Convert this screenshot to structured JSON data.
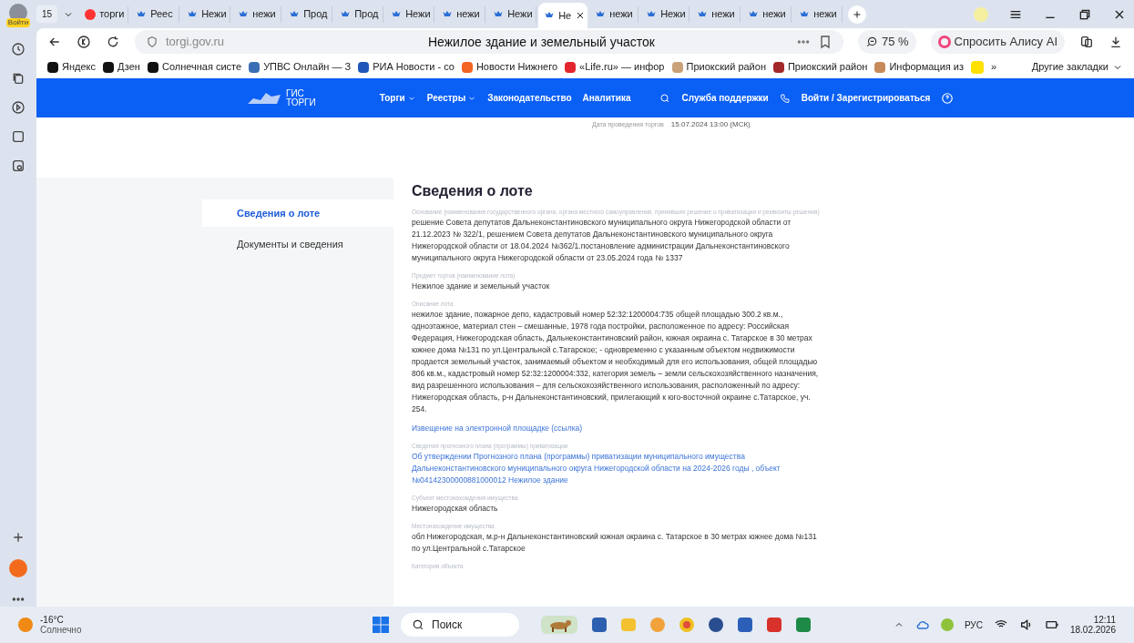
{
  "browser": {
    "login_label": "Войти",
    "tab_count": "15",
    "tabs": [
      {
        "label": "торги",
        "kind": "yandex",
        "selected": false
      },
      {
        "label": "Реес",
        "kind": "site",
        "selected": false
      },
      {
        "label": "Нежи",
        "kind": "site",
        "selected": false
      },
      {
        "label": "нежи",
        "kind": "site",
        "selected": false
      },
      {
        "label": "Прод",
        "kind": "site",
        "selected": false
      },
      {
        "label": "Прод",
        "kind": "site",
        "selected": false
      },
      {
        "label": "Нежи",
        "kind": "site",
        "selected": false
      },
      {
        "label": "нежи",
        "kind": "site",
        "selected": false
      },
      {
        "label": "Нежи",
        "kind": "site",
        "selected": false
      },
      {
        "label": "Не",
        "kind": "site",
        "selected": true
      },
      {
        "label": "нежи",
        "kind": "site",
        "selected": false
      },
      {
        "label": "Нежи",
        "kind": "site",
        "selected": false
      },
      {
        "label": "нежи",
        "kind": "site",
        "selected": false
      },
      {
        "label": "нежи",
        "kind": "site",
        "selected": false
      },
      {
        "label": "нежи",
        "kind": "site",
        "selected": false
      }
    ],
    "address": "torgi.gov.ru",
    "page_title": "Нежилое здание и земельный участок",
    "zoom": "75 %",
    "alice": "Спросить Алису AI",
    "bookmarks": [
      {
        "label": "Яндекс",
        "color": "#111111"
      },
      {
        "label": "Дзен",
        "color": "#111111"
      },
      {
        "label": "Солнечная систе",
        "color": "#111111"
      },
      {
        "label": "УПВС Онлайн — З",
        "color": "#3b6fb5"
      },
      {
        "label": "РИА Новости - со",
        "color": "#1f56b8"
      },
      {
        "label": "Новости Нижнего",
        "color": "#f26522"
      },
      {
        "label": "«Life.ru» — инфор",
        "color": "#e3262d"
      },
      {
        "label": "Приокский район",
        "color": "#c9a27a"
      },
      {
        "label": "Приокский район",
        "color": "#a3282a"
      },
      {
        "label": "Информация из",
        "color": "#c78a5a"
      }
    ],
    "more": "»",
    "other_bookmarks": "Другие закладки"
  },
  "site": {
    "logo_line1": "ГИС",
    "logo_line2": "ТОРГИ",
    "nav": [
      {
        "label": "Торги",
        "kind": "menu"
      },
      {
        "label": "Реестры",
        "kind": "menu"
      },
      {
        "label": "Законодательство",
        "kind": "link"
      },
      {
        "label": "Аналитика",
        "kind": "link"
      }
    ],
    "support": "Служба поддержки",
    "login": "Войти / Зарегистрироваться",
    "date_label": "Дата проведения торгов",
    "date_value": "15.07.2024 13:00 (МСК)",
    "side_menu": [
      {
        "label": "Сведения о лоте",
        "selected": true
      },
      {
        "label": "Документы и сведения",
        "selected": false
      }
    ],
    "heading": "Сведения о лоте",
    "fields": [
      {
        "label": "Основание (наименование государственного органа, органа местного самоуправления, принявших решение о приватизации и реквизиты решения)",
        "value": "решение Совета  депутатов Дальнеконстантиновского муниципального  округа  Нижегородской области от 21.12.2023  № 322/1, решением Совета  депутатов Дальнеконстантиновского муниципального  округа Нижегородской области   от 18.04.2024 №362/1.постановление администрации Дальнеконстантиновского муниципального округа Нижегородской области от 23.05.2024 года № 1337",
        "kind": "text"
      },
      {
        "label": "Предмет торгов (наименование лота)",
        "value": "Нежилое здание и земельный участок",
        "kind": "text"
      },
      {
        "label": "Описание лота",
        "value": "нежилое здание, пожарное депо, кадастровый номер 52:32:1200004:735 общей площадью 300.2 кв.м., одноэтажное, материал стен – смешанные, 1978 года постройки, расположенное по адресу: Российская Федерация, Нижегородская область, Дальнеконстантиновский район, южная окраина с. Татарское в 30 метрах южнее дома №131 по ул.Центральной с.Татарское; - одновременно с указанным объектом недвижимости продается земельный участок, занимаемый объектом и необходимый для его использования, общей площадью 806 кв.м., кадастровый номер 52:32:1200004:332, категория земель – земли сельскохозяйственного назначения, вид разрешенного использования – для сельскохозяйственного использования, расположенный по адресу: Нижегородская область, р-н Дальнеконстантиновский, прилегающий к юго-восточной окраине с.Татарское, уч. 254.",
        "kind": "text"
      },
      {
        "value": "Извещение на электронной площадке (ссылка)",
        "kind": "link"
      },
      {
        "label": "Сведения прогнозного плана (программы) приватизации",
        "value": "Об утверждении Прогнозного плана (программы) приватизации муниципального имущества Дальнеконстантиновского муниципального округа Нижегородской области на 2024-2026 годы , объект №04142300000881000012 Нежилое здание",
        "kind": "link"
      },
      {
        "label": "Субъект местонахождения имущества",
        "value": "Нижегородская область",
        "kind": "text"
      },
      {
        "label": "Местонахождение имущества",
        "value": "обл Нижегородская, м.р-н Дальнеконстантиновский южная окраина с. Татарское в 30 метрах южнее дома №131 по ул.Центральной с.Татарское",
        "kind": "text"
      },
      {
        "label": "Категория объекта"
      }
    ]
  },
  "taskbar": {
    "temperature": "-16°C",
    "weather": "Солнечно",
    "search_placeholder": "Поиск",
    "language": "РУС",
    "time": "12:11",
    "date": "18.02.2026"
  }
}
